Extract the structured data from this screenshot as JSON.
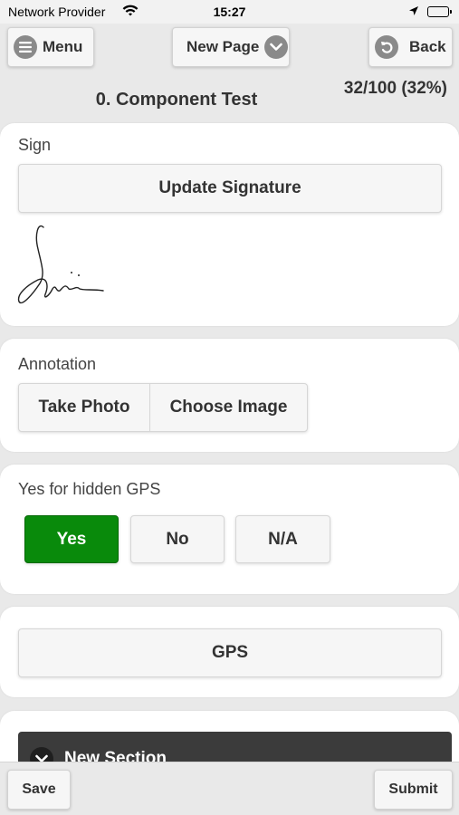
{
  "status_bar": {
    "carrier": "Network Provider",
    "time": "15:27"
  },
  "header": {
    "menu_label": "Menu",
    "new_page_label": "New Page",
    "back_label": "Back",
    "title": "0. Component Test",
    "progress": "32/100 (32%)",
    "progress_value": 0.32
  },
  "sign_card": {
    "label": "Sign",
    "update_button": "Update Signature"
  },
  "annotation_card": {
    "label": "Annotation",
    "take_photo": "Take Photo",
    "choose_image": "Choose Image"
  },
  "gps_question_card": {
    "label": "Yes for hidden GPS",
    "options": [
      "Yes",
      "No",
      "N/A"
    ],
    "selected": "Yes",
    "selected_color": "#098a0b"
  },
  "gps_card": {
    "button": "GPS"
  },
  "section": {
    "title": "New Section"
  },
  "footer": {
    "save_label": "Save",
    "submit_label": "Submit"
  }
}
